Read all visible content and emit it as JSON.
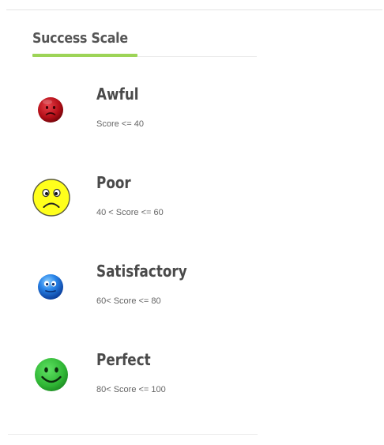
{
  "title": "Success Scale",
  "colors": {
    "accent_underline": "#9dd457",
    "awful": "#c1121b",
    "poor": "#ffff19",
    "satisfactory": "#1f77e0",
    "perfect": "#34c23a"
  },
  "levels": [
    {
      "name": "Awful",
      "range": "Score <= 40",
      "icon": "sad-red-face-icon"
    },
    {
      "name": "Poor",
      "range": "40 < Score <= 60",
      "icon": "frowning-yellow-face-icon"
    },
    {
      "name": "Satisfactory",
      "range": "60< Score <= 80",
      "icon": "neutral-blue-face-icon"
    },
    {
      "name": "Perfect",
      "range": "80< Score <= 100",
      "icon": "smiling-green-face-icon"
    }
  ]
}
